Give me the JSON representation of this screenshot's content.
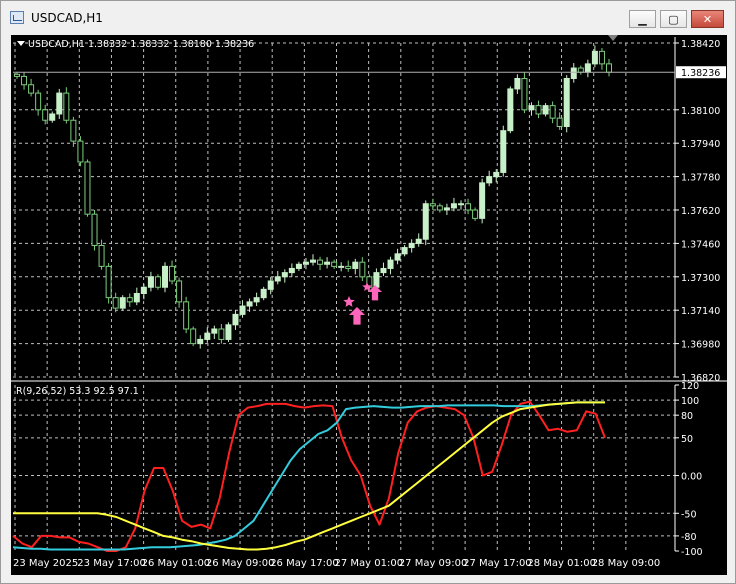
{
  "window": {
    "title": "USDCAD,H1",
    "minimize_label": "▁",
    "maximize_label": "▢",
    "close_label": "✕"
  },
  "chart": {
    "header": "USDCAD,H1  1.38332 1.38332 1.38180 1.38236",
    "current_price_label": "1.38236",
    "indicator_label": "R(9,26,52) 53.3 92.5 97.1",
    "colors": {
      "background": "#000000",
      "grid": "#c0c0c0",
      "bull_candle": "#c8f0c8",
      "bear_candle": "#7ccd7c",
      "series_red": "#ff2020",
      "series_cyan": "#33ccdd",
      "series_yellow": "#ffff40",
      "signal_pink": "#ff66bb"
    },
    "icons": [
      "collapse-triangle-icon",
      "star-signal-icon",
      "up-arrow-signal-icon"
    ]
  },
  "chart_data": [
    {
      "type": "candlestick",
      "title": "",
      "y_ticks": [
        "1.38420",
        "1.38100",
        "1.37940",
        "1.37780",
        "1.37620",
        "1.37460",
        "1.37300",
        "1.37140",
        "1.36980",
        "1.36820"
      ],
      "x_ticks": [
        "23 May 2025",
        "23 May 17:00",
        "26 May 01:00",
        "26 May 09:00",
        "26 May 17:00",
        "27 May 01:00",
        "27 May 09:00",
        "27 May 17:00",
        "28 May 01:00",
        "28 May 09:00"
      ],
      "ylim": [
        1.3682,
        1.3842
      ],
      "close_series": [
        1.3826,
        1.3822,
        1.3818,
        1.381,
        1.3805,
        1.3808,
        1.3818,
        1.3805,
        1.3795,
        1.3785,
        1.376,
        1.3745,
        1.3735,
        1.372,
        1.3715,
        1.372,
        1.3718,
        1.3722,
        1.3725,
        1.373,
        1.3725,
        1.3735,
        1.3728,
        1.3718,
        1.3705,
        1.3698,
        1.37,
        1.3703,
        1.3705,
        1.37,
        1.3707,
        1.3712,
        1.3716,
        1.3718,
        1.372,
        1.3724,
        1.3728,
        1.373,
        1.3732,
        1.3734,
        1.3736,
        1.3737,
        1.3738,
        1.3736,
        1.3737,
        1.3735,
        1.3735,
        1.3734,
        1.3737,
        1.373,
        1.3725,
        1.3732,
        1.3734,
        1.3738,
        1.3741,
        1.3744,
        1.3746,
        1.3748,
        1.3765,
        1.3764,
        1.3762,
        1.3763,
        1.3765,
        1.3765,
        1.3762,
        1.3758,
        1.3775,
        1.3778,
        1.378,
        1.38,
        1.382,
        1.3825,
        1.381,
        1.3812,
        1.3808,
        1.3812,
        1.3806,
        1.3802,
        1.3825,
        1.383,
        1.3828,
        1.3832,
        1.3838,
        1.3832,
        1.3828
      ]
    },
    {
      "type": "line",
      "title": "",
      "y_ticks": [
        "120",
        "100",
        "80",
        "50",
        "0.00",
        "-50",
        "-80",
        "-100"
      ],
      "ylim": [
        -100,
        120
      ],
      "series": [
        {
          "values": [
            -80,
            -90,
            -95,
            -80,
            -80,
            -82,
            -82,
            -88,
            -90,
            -95,
            -100,
            -100,
            -95,
            -70,
            -20,
            10,
            10,
            -20,
            -60,
            -68,
            -65,
            -70,
            -30,
            30,
            80,
            90,
            92,
            95,
            95,
            95,
            92,
            90,
            92,
            93,
            92,
            50,
            20,
            0,
            -40,
            -65,
            -30,
            30,
            70,
            85,
            90,
            92,
            90,
            88,
            80,
            50,
            0,
            5,
            40,
            80,
            95,
            98,
            80,
            60,
            62,
            58,
            60,
            85,
            82,
            50
          ]
        },
        {
          "values": [
            -95,
            -96,
            -97,
            -97,
            -98,
            -98,
            -98,
            -98,
            -98,
            -98,
            -98,
            -98,
            -98,
            -97,
            -96,
            -95,
            -95,
            -95,
            -94,
            -93,
            -92,
            -90,
            -88,
            -85,
            -80,
            -70,
            -60,
            -40,
            -20,
            0,
            20,
            35,
            45,
            55,
            60,
            70,
            88,
            90,
            91,
            92,
            91,
            90,
            90,
            91,
            92,
            92,
            92,
            93,
            93,
            93,
            93,
            93,
            93,
            92,
            92,
            92,
            92,
            93,
            94,
            95,
            96,
            97,
            97,
            97,
            97
          ]
        },
        {
          "values": [
            -50,
            -50,
            -50,
            -50,
            -50,
            -50,
            -50,
            -50,
            -50,
            -50,
            -52,
            -55,
            -60,
            -65,
            -70,
            -75,
            -80,
            -82,
            -85,
            -87,
            -90,
            -92,
            -94,
            -96,
            -97,
            -98,
            -98,
            -97,
            -95,
            -92,
            -88,
            -85,
            -80,
            -75,
            -70,
            -65,
            -60,
            -55,
            -50,
            -45,
            -40,
            -30,
            -20,
            -10,
            0,
            10,
            20,
            30,
            40,
            50,
            60,
            70,
            78,
            83,
            88,
            90,
            92,
            94,
            95,
            96,
            97,
            97,
            97,
            97
          ]
        }
      ]
    }
  ]
}
